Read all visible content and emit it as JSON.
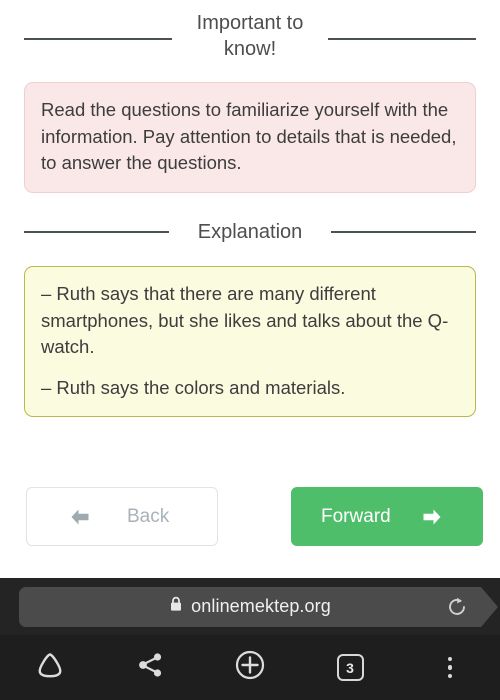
{
  "sections": {
    "important": {
      "heading": "Important to know!",
      "body": "Read the questions to familiarize yourself with the information. Pay attention to details that is needed, to answer the questions."
    },
    "explanation": {
      "heading": "Explanation",
      "lines": [
        "– Ruth says that there are many different smartphones, but she likes and talks about the Q-watch.",
        "– Ruth says the colors and materials."
      ]
    }
  },
  "buttons": {
    "back": {
      "label": "Back",
      "icon": "arrow-left-icon"
    },
    "forward": {
      "label": "Forward",
      "icon": "arrow-right-icon",
      "color": "#4fbe6b"
    }
  },
  "browser": {
    "url": "onlinemektep.org",
    "lock_icon": "lock-icon",
    "reload_icon": "reload-icon",
    "nav": {
      "home_icon": "home-icon",
      "share_icon": "share-icon",
      "add_icon": "plus-circle-icon",
      "tabs_count": "3",
      "menu_icon": "overflow-menu-icon"
    }
  },
  "colors": {
    "important_bg": "#fae7e7",
    "important_border": "#f0cfcf",
    "explanation_bg": "#fbfbdf",
    "explanation_border": "#b9b94f",
    "forward_green": "#4fbe6b",
    "chrome_dark": "#242424",
    "nav_dark": "#1e1e1e"
  }
}
